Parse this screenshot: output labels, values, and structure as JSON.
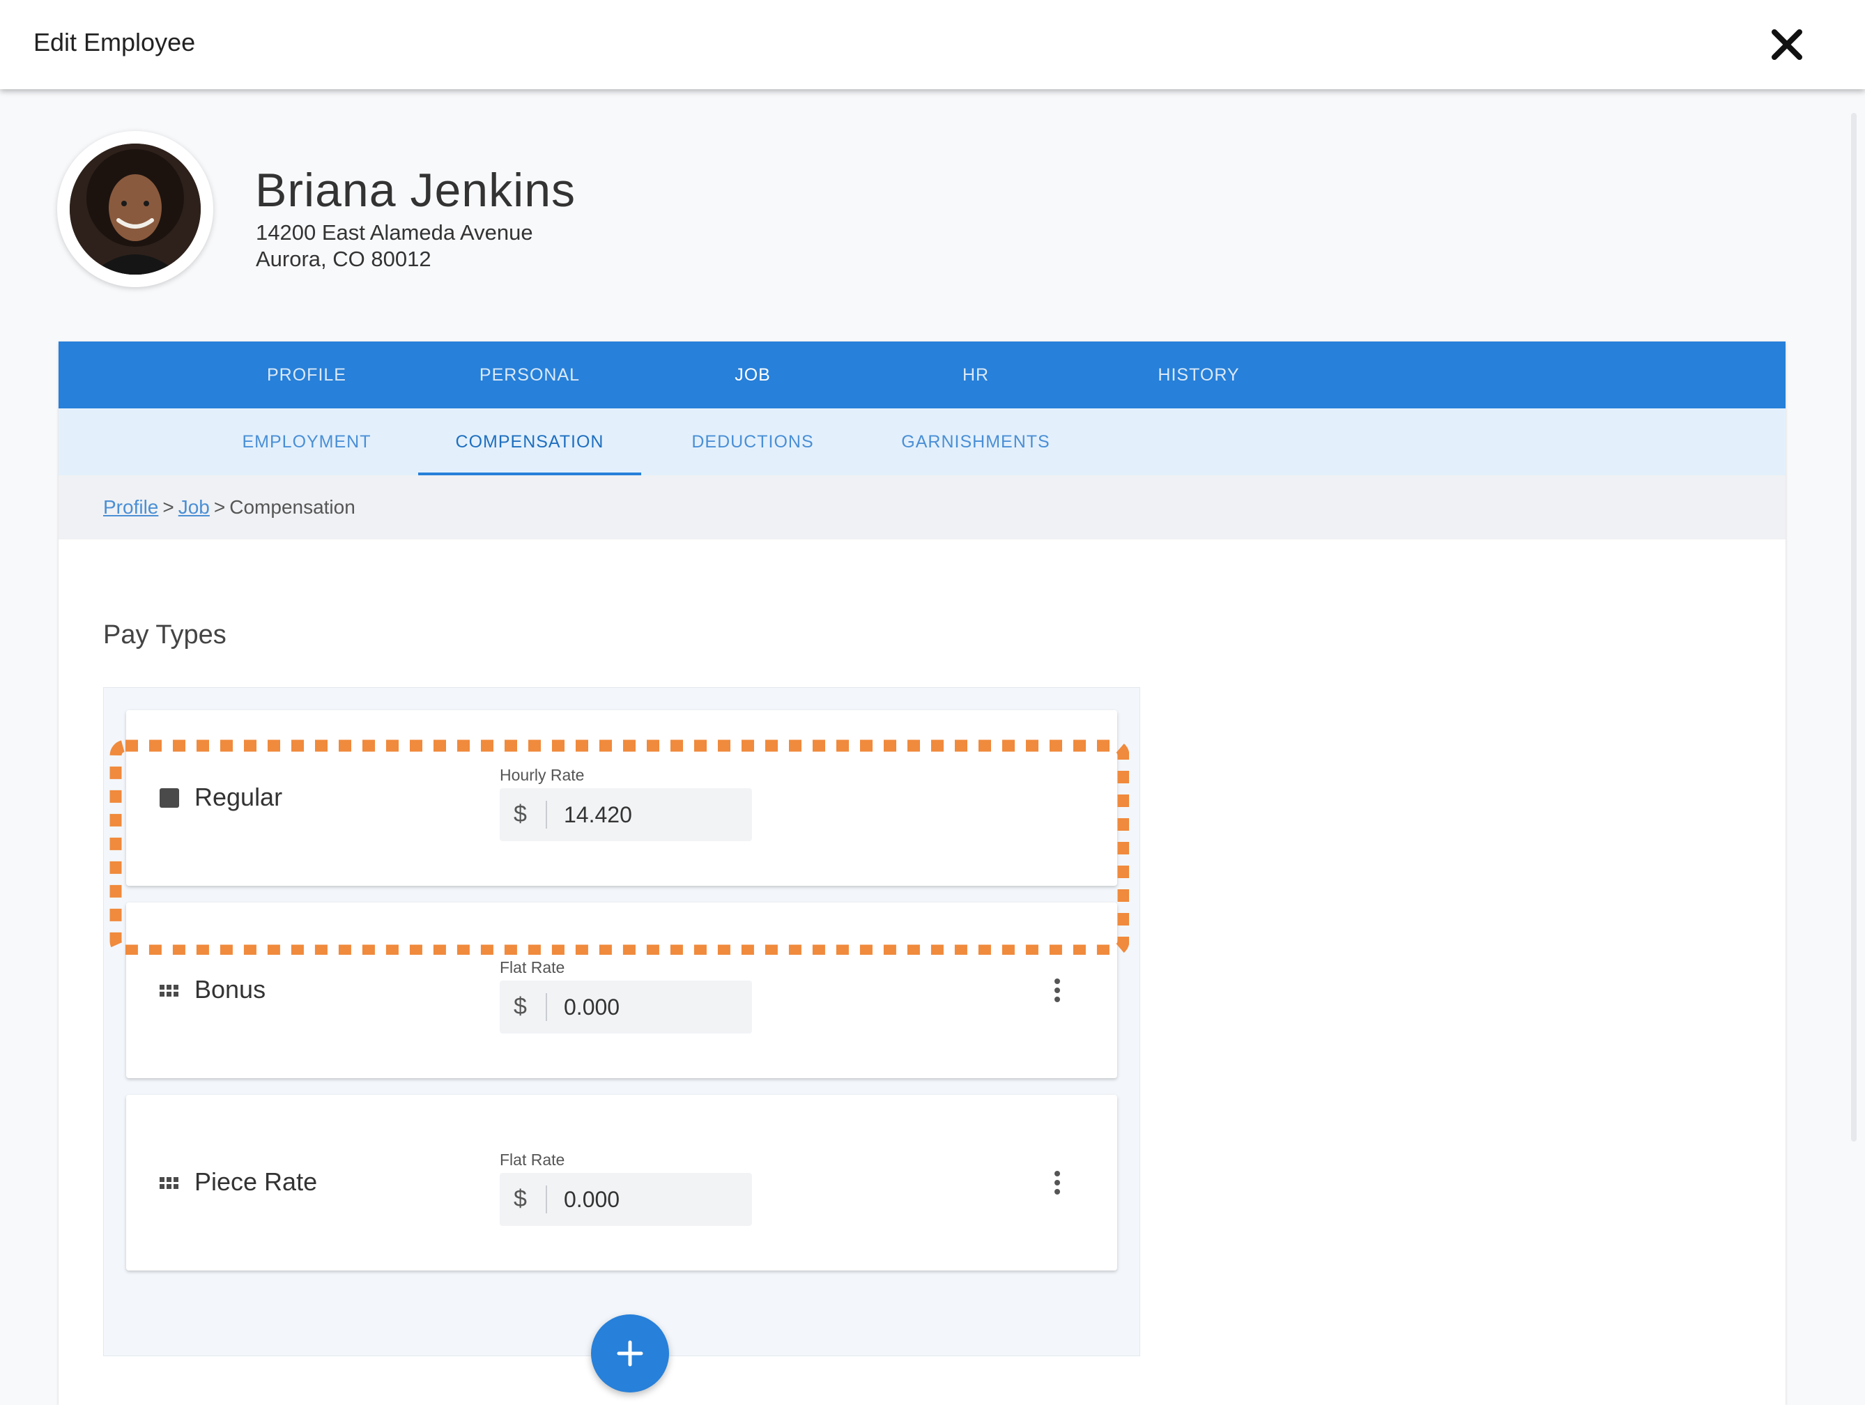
{
  "header": {
    "title": "Edit Employee",
    "close_icon": "close-icon"
  },
  "employee": {
    "name": "Briana Jenkins",
    "address_line1": "14200 East Alameda Avenue",
    "address_line2": "Aurora, CO 80012"
  },
  "primary_tabs": [
    {
      "label": "PROFILE",
      "active": false
    },
    {
      "label": "PERSONAL",
      "active": false
    },
    {
      "label": "JOB",
      "active": true
    },
    {
      "label": "HR",
      "active": false
    },
    {
      "label": "HISTORY",
      "active": false
    }
  ],
  "secondary_tabs": [
    {
      "label": "EMPLOYMENT",
      "active": false
    },
    {
      "label": "COMPENSATION",
      "active": true
    },
    {
      "label": "DEDUCTIONS",
      "active": false
    },
    {
      "label": "GARNISHMENTS",
      "active": false
    }
  ],
  "breadcrumb": {
    "item1": "Profile",
    "item2": "Job",
    "current": "Compensation",
    "separator": ">"
  },
  "pay_types": {
    "title": "Pay Types",
    "items": [
      {
        "name": "Regular",
        "field_label": "Hourly Rate",
        "currency": "$",
        "value": "14.420",
        "icon": "square-icon"
      },
      {
        "name": "Bonus",
        "field_label": "Flat Rate",
        "currency": "$",
        "value": "0.000",
        "icon": "drag-handle-icon"
      },
      {
        "name": "Piece Rate",
        "field_label": "Flat Rate",
        "currency": "$",
        "value": "0.000",
        "icon": "drag-handle-icon"
      }
    ]
  },
  "colors": {
    "primary": "#2780d9",
    "highlight": "#f08a3c",
    "secondary_tab_bg": "#e3f0fc"
  }
}
